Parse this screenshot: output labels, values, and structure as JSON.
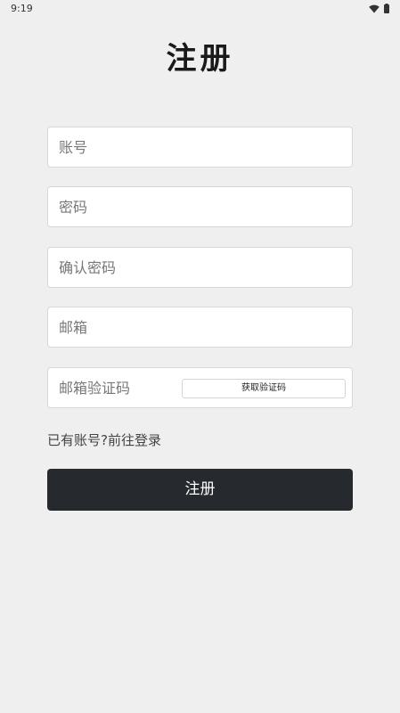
{
  "status_bar": {
    "time": "9:19",
    "icons": [
      "wifi-icon",
      "battery-icon"
    ]
  },
  "page": {
    "title": "注册"
  },
  "form": {
    "account_placeholder": "账号",
    "password_placeholder": "密码",
    "confirm_password_placeholder": "确认密码",
    "email_placeholder": "邮箱",
    "email_code_placeholder": "邮箱验证码",
    "get_code_label": "获取验证码",
    "login_link": "已有账号?前往登录",
    "submit_label": "注册"
  },
  "colors": {
    "background": "#efefef",
    "submit_button": "#26292e",
    "field_border": "#d7d7d7"
  }
}
